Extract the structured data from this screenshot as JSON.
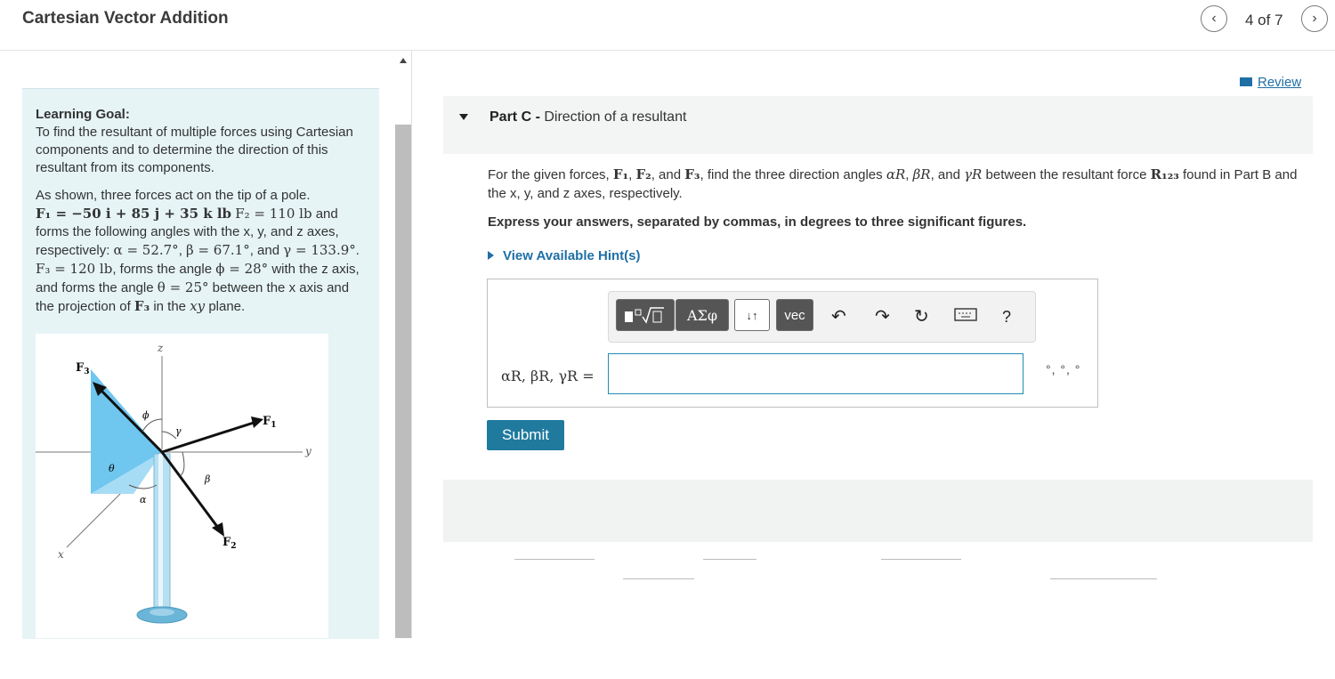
{
  "header": {
    "title": "Cartesian Vector Addition",
    "pager": "4 of 7",
    "prev_icon": "chevron-left-icon",
    "next_icon": "chevron-right-icon"
  },
  "learning": {
    "goal_heading": "Learning Goal:",
    "goal_text": "To find the resultant of multiple forces using Cartesian components and to determine the direction of this resultant from its components.",
    "shown_intro": "As shown, three forces act on the tip of a pole.",
    "f1": "F₁ = −50 i + 85 j + 35 k lb",
    "f2_label": "F₂ = 110 lb",
    "angles_intro": "and forms the following angles with the x, y, and z axes, respectively:",
    "alpha": "α = 52.7°",
    "beta": "β = 67.1°",
    "gamma": "γ = 133.9°",
    "f3": "F₃ = 120 lb",
    "f3_text_a": ", forms the angle",
    "phi": "ϕ = 28°",
    "phi_text": "with the z axis, and forms the angle",
    "theta": "θ = 25°",
    "theta_text": "between the x axis and the projection of",
    "f3_sym": "F₃",
    "plane_text": "in the",
    "plane": "xy",
    "plane_end": "plane."
  },
  "figure": {
    "labels": {
      "f1": "F",
      "f1_sub": "1",
      "f2": "F",
      "f2_sub": "2",
      "f3": "F",
      "f3_sub": "3",
      "x": "x",
      "y": "y",
      "z": "z",
      "alpha": "α",
      "beta": "β",
      "gamma": "γ",
      "phi": "ϕ",
      "theta": "θ"
    }
  },
  "right": {
    "review_label": "Review",
    "part_label": "Part C",
    "part_sep": " - ",
    "part_title": "Direction of a resultant",
    "prompt_a": "For the given forces,",
    "prompt_f1": "F₁",
    "prompt_f2": "F₂",
    "prompt_and": ", and",
    "prompt_f3": "F₃",
    "prompt_b": ", find the three direction angles",
    "alpha_r": "αR",
    "beta_r": "βR",
    "gamma_r": "γR",
    "prompt_c": "between the resultant force",
    "r123": "R₁₂₃",
    "prompt_d": "found in Part B and the x, y, and z axes, respectively.",
    "express": "Express your answers, separated by commas, in degrees to three significant figures.",
    "hint": "View Available Hint(s)",
    "toolbar": {
      "greek": "ΑΣφ",
      "arrows": "↓↑",
      "vec": "vec",
      "help": "?"
    },
    "answer_label": "αR, βR, γR =",
    "answer_value": "",
    "units": "°, °, °",
    "submit": "Submit"
  }
}
